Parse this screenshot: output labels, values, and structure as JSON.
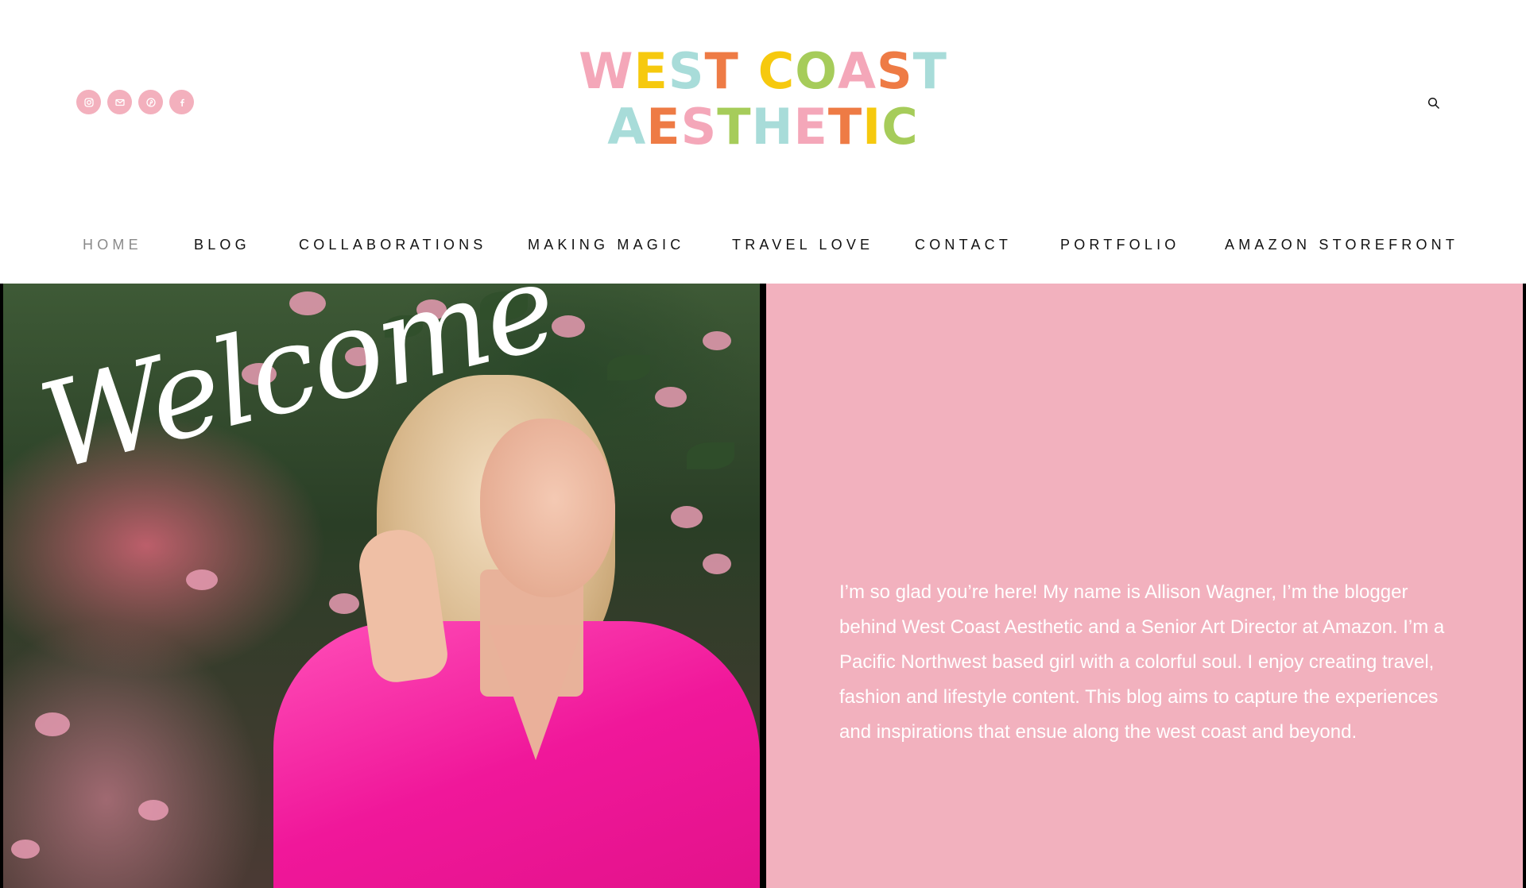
{
  "social_icons": [
    {
      "icon": "instagram-icon",
      "color": "#f3b0bd"
    },
    {
      "icon": "mail-icon",
      "color": "#f3b0bd"
    },
    {
      "icon": "pinterest-icon",
      "color": "#f3b0bd"
    },
    {
      "icon": "facebook-icon",
      "color": "#f3b0bd"
    }
  ],
  "logo": {
    "line1": "WEST COAST",
    "line2": "AESTHETIC",
    "colors": [
      "#f4a7b9",
      "#f6c90e",
      "#a8dcd9",
      "#ee7b45",
      "#a6cc5a"
    ]
  },
  "nav": {
    "items": [
      {
        "label": "HOME",
        "active": true
      },
      {
        "label": "BLOG"
      },
      {
        "label": "COLLABORATIONS"
      },
      {
        "label": "MAKING MAGIC"
      },
      {
        "label": "TRAVEL LOVE"
      },
      {
        "label": "CONTACT"
      },
      {
        "label": "PORTFOLIO"
      },
      {
        "label": "AMAZON STOREFRONT"
      }
    ]
  },
  "hero": {
    "welcome": "Welcome",
    "intro": "I’m so glad you’re here! My name is Allison Wagner, I’m the blogger behind West Coast Aesthetic and a Senior Art Director at Amazon. I’m a Pacific Northwest based girl with a colorful soul. I enjoy creating travel, fashion and lifestyle content. This blog aims to capture the experiences and inspirations that ensue along the west coast and beyond.",
    "panel_color": "#f2b1be"
  }
}
